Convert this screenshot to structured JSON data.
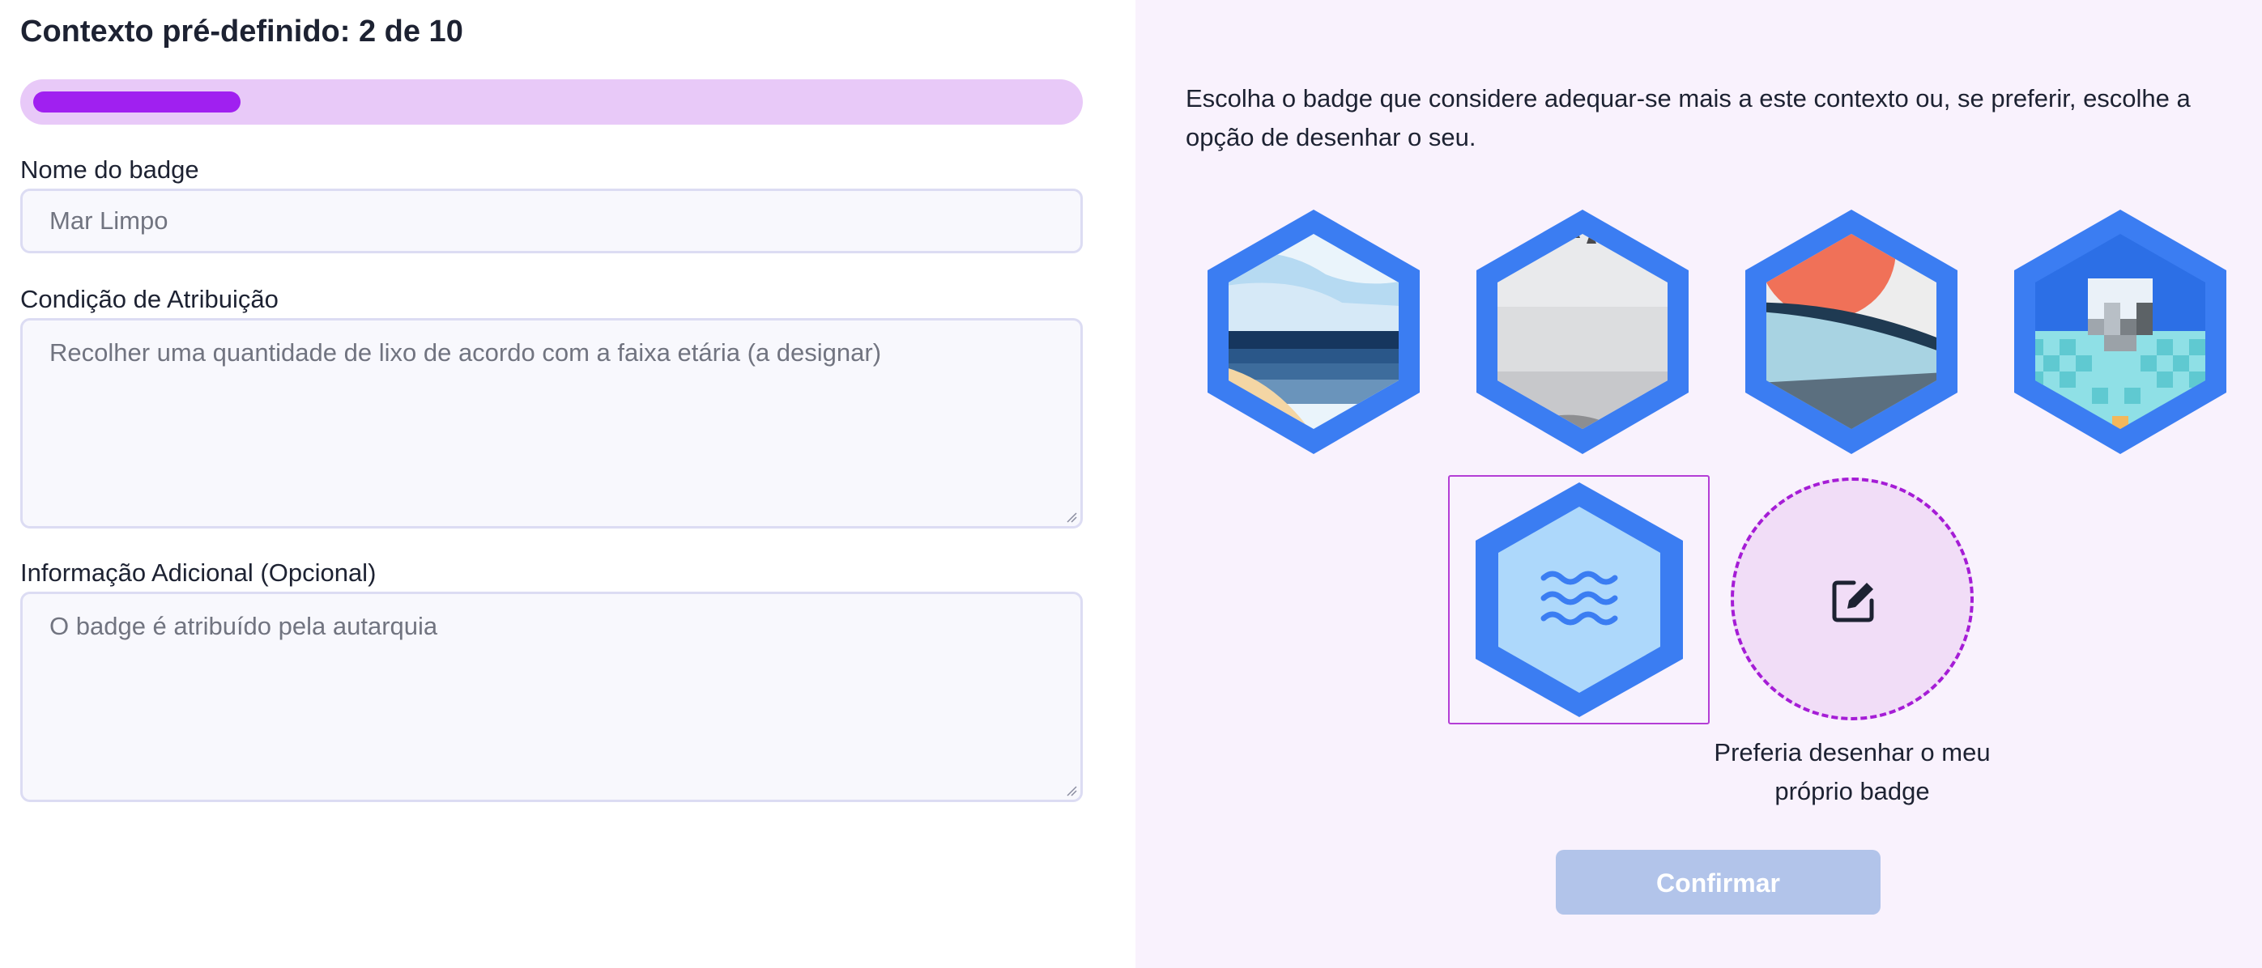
{
  "header": {
    "title": "Contexto pré-definido: 2 de 10"
  },
  "progress": {
    "current": 2,
    "total": 10
  },
  "form": {
    "name_label": "Nome do badge",
    "name_value": "Mar Limpo",
    "condition_label": "Condição de Atribuição",
    "condition_value": "Recolher uma quantidade de lixo de acordo com a faixa etária (a designar)",
    "info_label": "Informação Adicional (Opcional)",
    "info_value": "O badge é atribuído pela autarquia"
  },
  "chooser": {
    "intro": "Escolha o badge que considere adequar-se mais a este contexto ou, se preferir, escolhe a opção de desenhar o seu.",
    "badges": [
      {
        "icon": "beach-sea-image-icon",
        "selected": false
      },
      {
        "icon": "foggy-landscape-image-icon",
        "selected": false
      },
      {
        "icon": "sunset-waves-image-icon",
        "selected": false
      },
      {
        "icon": "pixel-iceberg-image-icon",
        "selected": false
      },
      {
        "icon": "water-waves-icon",
        "selected": true
      }
    ],
    "draw_own_label": "Preferia desenhar o meu próprio badge",
    "draw_icon": "edit-pencil-icon",
    "confirm_label": "Confirmar"
  },
  "colors": {
    "accent": "#a020f0",
    "badge_blue": "#3b7df2",
    "confirm_disabled": "#b2c4ea",
    "right_panel_bg": "#f9f2fd"
  }
}
